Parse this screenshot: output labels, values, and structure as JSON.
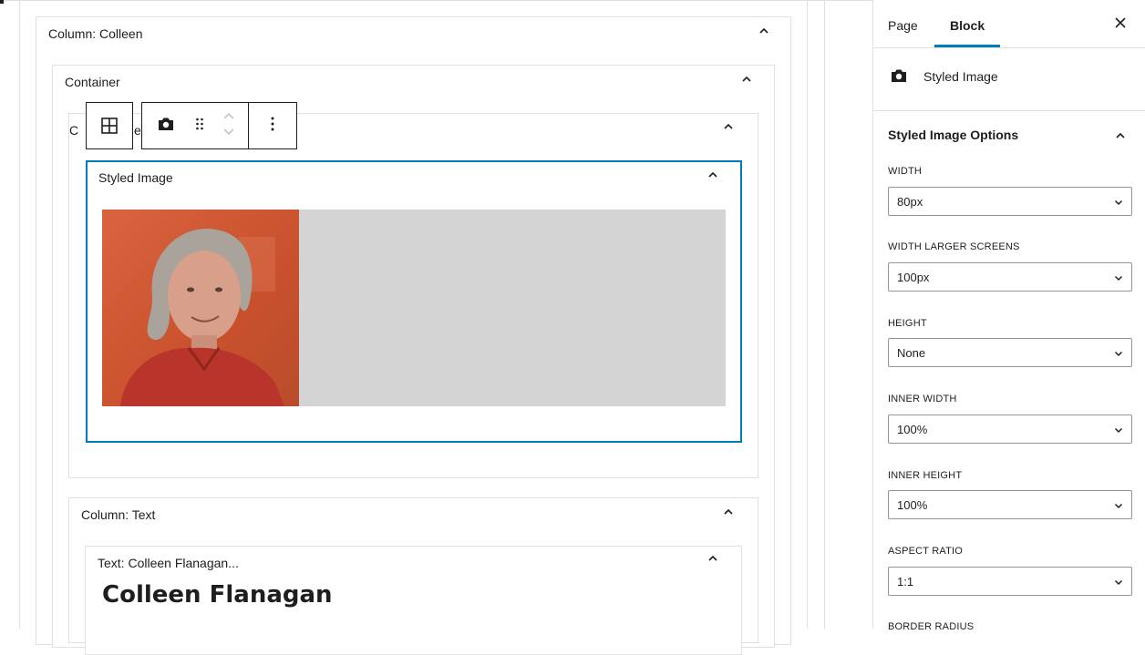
{
  "canvas": {
    "column_colleen": {
      "label": "Column: Colleen"
    },
    "container": {
      "label": "Container"
    },
    "inner_container": {
      "label_visible_fragment": "C",
      "label_tail_fragment": "er"
    },
    "styled_image": {
      "label": "Styled Image",
      "placeholder_color": "#d4d4d4",
      "accent_color": "#007cba"
    },
    "column_text": {
      "label": "Column: Text"
    },
    "text_block": {
      "label": "Text: Colleen Flanagan...",
      "heading": "Colleen Flanagan"
    }
  },
  "toolbar": {
    "parent_icon": "grid-icon",
    "block_icon": "camera-icon",
    "drag_icon": "drag-handle-icon",
    "move_icon": "move-up-down-icon",
    "options_icon": "more-vertical-icon"
  },
  "sidebar": {
    "tabs": [
      {
        "label": "Page",
        "active": false
      },
      {
        "label": "Block",
        "active": true
      }
    ],
    "close_icon": "close-icon",
    "block_card": {
      "icon": "camera-icon",
      "title": "Styled Image"
    },
    "panel": {
      "title": "Styled Image Options",
      "fields": [
        {
          "label": "WIDTH",
          "value": "80px"
        },
        {
          "label": "WIDTH LARGER SCREENS",
          "value": "100px"
        },
        {
          "label": "HEIGHT",
          "value": "None"
        },
        {
          "label": "INNER WIDTH",
          "value": "100%"
        },
        {
          "label": "INNER HEIGHT",
          "value": "100%"
        },
        {
          "label": "ASPECT RATIO",
          "value": "1:1"
        }
      ],
      "cut_off_label": "BORDER RADIUS"
    }
  }
}
